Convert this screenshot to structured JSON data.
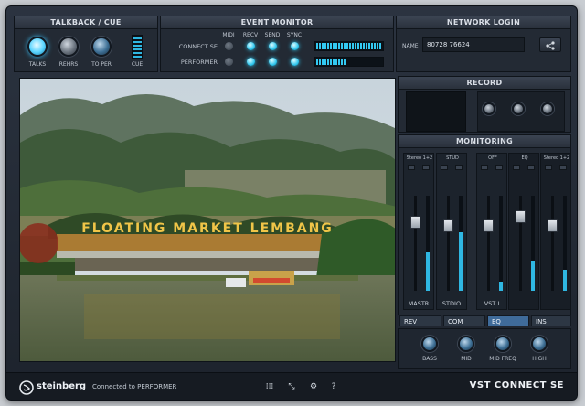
{
  "talkback": {
    "title": "TALKBACK / CUE",
    "talk_label": "TALKS",
    "rehrs_label": "REHRS",
    "to_per_label": "TO PER",
    "cue_label": "CUE"
  },
  "event_monitor": {
    "title": "EVENT MONITOR",
    "columns": [
      "MIDI",
      "RECV",
      "SEND",
      "SYNC"
    ],
    "rows": [
      "CONNECT SE",
      "PERFORMER"
    ]
  },
  "network": {
    "title": "NETWORK LOGIN",
    "name_label": "NAME",
    "name_value": "80728 76624"
  },
  "record": {
    "title": "RECORD"
  },
  "monitoring": {
    "title": "MONITORING",
    "channels": [
      {
        "top": "Stereo 1+2",
        "label": "MASTR"
      },
      {
        "top": "STUD",
        "label": "STDIO"
      },
      {
        "top": "OFF",
        "label": "VST I"
      },
      {
        "top": "EQ",
        "label": ""
      },
      {
        "top": "Stereo 1+2",
        "label": ""
      }
    ],
    "tabs": [
      "REV",
      "COM",
      "EQ",
      "INS"
    ],
    "eq_knobs": [
      "BASS",
      "MID",
      "MID FREQ",
      "HIGH"
    ]
  },
  "video": {
    "sign_text": "FLOATING MARKET LEMBANG"
  },
  "footer": {
    "brand": "steinberg",
    "status": "Connected to PERFORMER",
    "product": "VST CONNECT SE"
  },
  "colors": {
    "accent": "#2ec6ee",
    "tab_selected": "#3f6b9a"
  }
}
